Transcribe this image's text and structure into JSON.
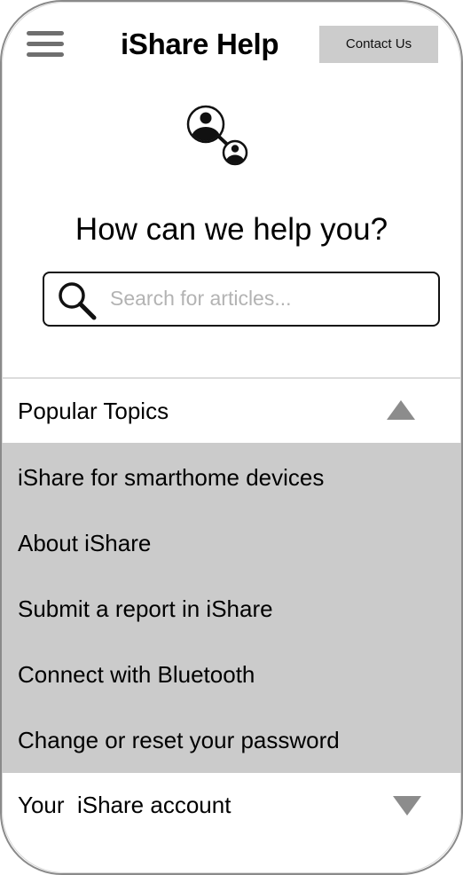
{
  "header": {
    "menu_icon": "hamburger-menu-icon",
    "title": "iShare Help",
    "contact_label": "Contact Us"
  },
  "hero": {
    "icon": "share-people-icon",
    "heading": "How can we help you?"
  },
  "search": {
    "icon": "search-icon",
    "placeholder": "Search for articles...",
    "value": ""
  },
  "popular": {
    "label": "Popular Topics",
    "expanded": true,
    "toggle_icon": "collapse-triangle-icon",
    "items": [
      {
        "label": "iShare for smarthome devices"
      },
      {
        "label": "About iShare"
      },
      {
        "label": "Submit a report in iShare"
      },
      {
        "label": "Connect with Bluetooth"
      },
      {
        "label": "Change or reset your password"
      }
    ]
  },
  "account": {
    "label": "Your  iShare account",
    "expanded": false,
    "toggle_icon": "expand-triangle-icon"
  },
  "colors": {
    "panel_bg": "#cbcbcb",
    "button_bg": "#cccccc",
    "icon_gray": "#8c8c8c",
    "frame": "#8a8a8a"
  }
}
